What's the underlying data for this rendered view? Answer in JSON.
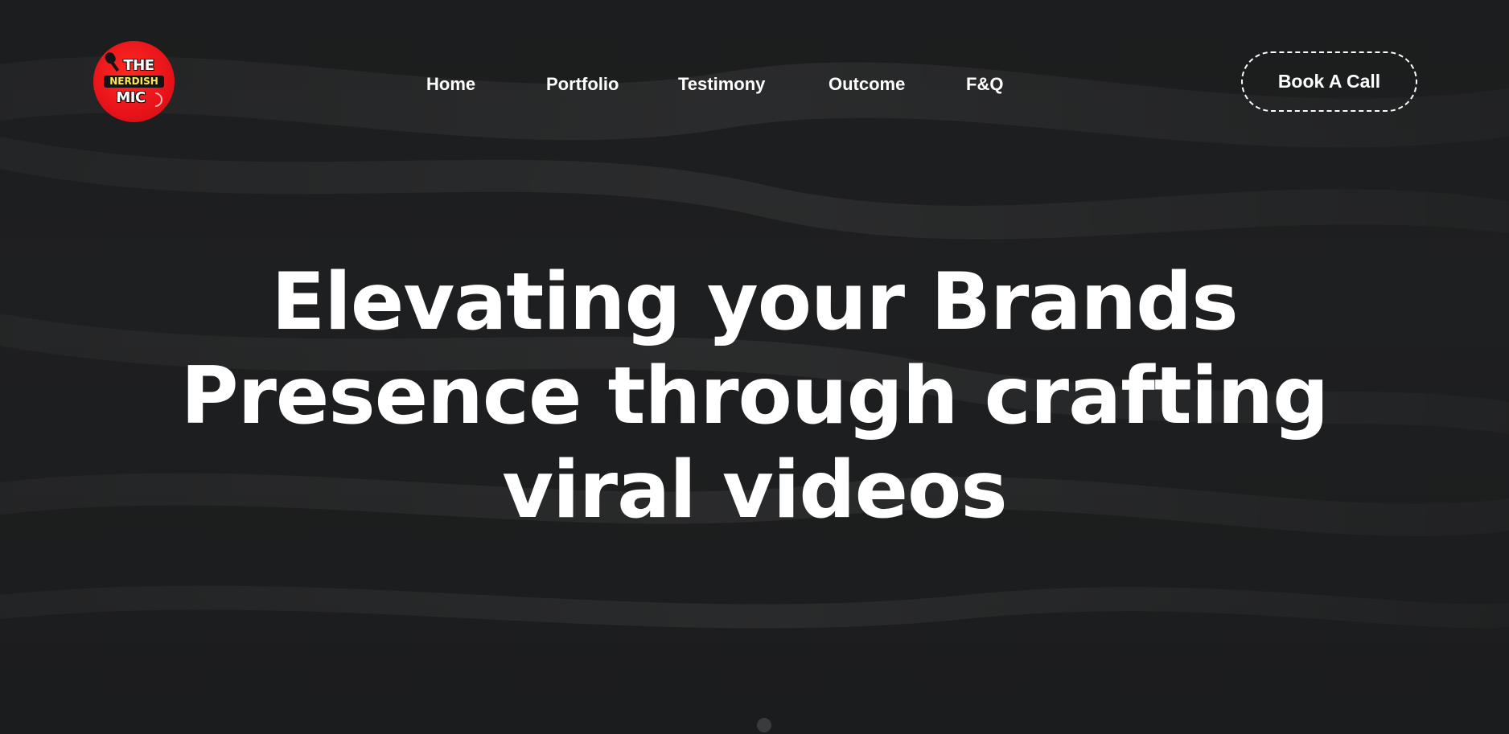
{
  "brand": {
    "logo_line1": "THE",
    "logo_line2": "NERDISH",
    "logo_line3": "MIC",
    "logo_color": "#e8131a",
    "logo_accent": "#ffe94d"
  },
  "nav": {
    "items": [
      {
        "label": "Home"
      },
      {
        "label": "Portfolio"
      },
      {
        "label": "Testimony"
      },
      {
        "label": "Outcome"
      },
      {
        "label": "F&Q"
      }
    ]
  },
  "cta": {
    "label": "Book A Call"
  },
  "hero": {
    "lines": [
      "Elevating your Brands",
      "Presence through crafting",
      "viral videos"
    ]
  },
  "colors": {
    "background": "#1b1c1d",
    "text": "#ffffff"
  },
  "icons": {
    "logo": "microphone-logo-icon",
    "scroll": "scroll-indicator-dot"
  }
}
